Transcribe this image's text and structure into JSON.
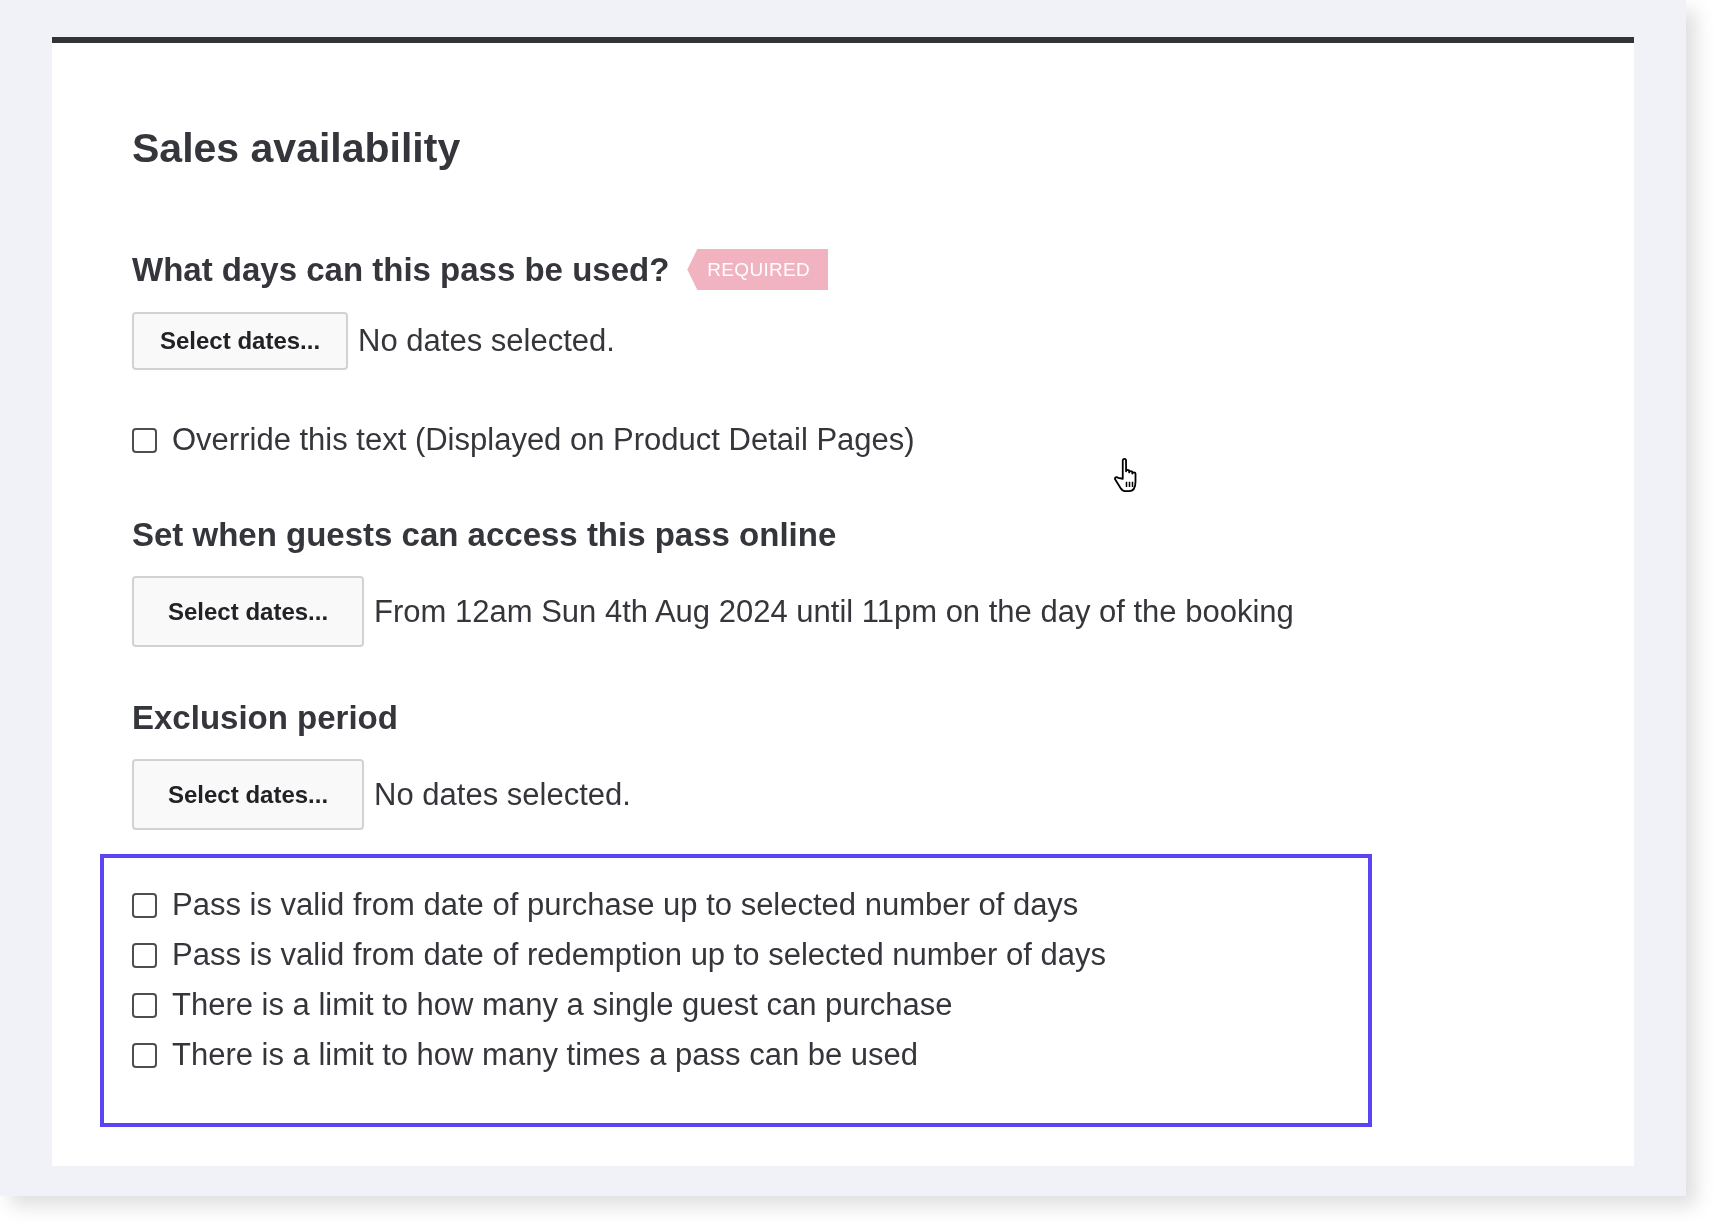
{
  "title": "Sales availability",
  "usage_days": {
    "heading": "What days can this pass be used?",
    "badge": "REQUIRED",
    "button": "Select dates...",
    "summary": "No dates selected.",
    "override": {
      "label": "Override this text (Displayed on Product Detail Pages)",
      "checked": false
    }
  },
  "online_access": {
    "heading": "Set when guests can access this pass online",
    "button": "Select dates...",
    "summary": "From 12am Sun 4th Aug 2024 until 11pm on the day of the booking"
  },
  "exclusion_period": {
    "heading": "Exclusion period",
    "button": "Select dates...",
    "summary": "No dates selected."
  },
  "options": {
    "highlighted": true,
    "items": [
      {
        "label": "Pass is valid from date of purchase up to selected number of days",
        "checked": false
      },
      {
        "label": "Pass is valid from date of redemption up to selected number of days",
        "checked": false
      },
      {
        "label": "There is a limit to how many a single guest can purchase",
        "checked": false
      },
      {
        "label": "There is a limit to how many times a pass can be used",
        "checked": false
      }
    ]
  }
}
